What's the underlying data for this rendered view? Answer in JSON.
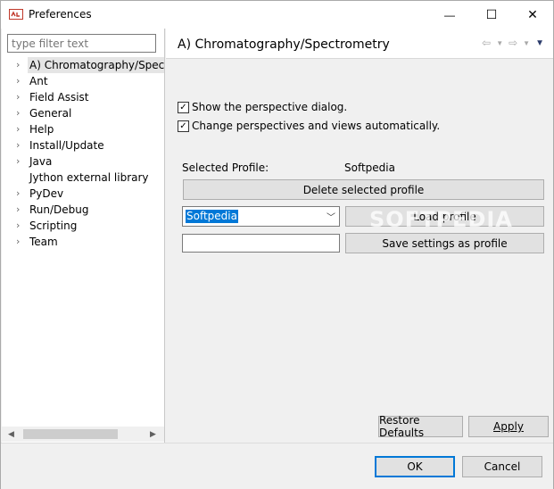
{
  "window": {
    "title": "Preferences",
    "minimize_glyph": "—",
    "maximize_glyph": "☐",
    "close_glyph": "✕"
  },
  "sidebar": {
    "filter_placeholder": "type filter text",
    "items": [
      {
        "label": "A) Chromatography/Spectrometry",
        "expandable": true,
        "selected": true
      },
      {
        "label": "Ant",
        "expandable": true
      },
      {
        "label": "Field Assist",
        "expandable": true
      },
      {
        "label": "General",
        "expandable": true
      },
      {
        "label": "Help",
        "expandable": true
      },
      {
        "label": "Install/Update",
        "expandable": true
      },
      {
        "label": "Java",
        "expandable": true
      },
      {
        "label": "Jython external library",
        "expandable": false
      },
      {
        "label": "PyDev",
        "expandable": true
      },
      {
        "label": "Run/Debug",
        "expandable": true
      },
      {
        "label": "Scripting",
        "expandable": true
      },
      {
        "label": "Team",
        "expandable": true
      }
    ]
  },
  "page": {
    "title": "A) Chromatography/Spectrometry",
    "show_perspective_dialog": {
      "label": "Show the perspective dialog.",
      "checked": true
    },
    "change_perspectives": {
      "label": "Change perspectives and views automatically.",
      "checked": true
    },
    "selected_profile_label": "Selected Profile:",
    "selected_profile_value": "Softpedia",
    "delete_profile_button": "Delete selected profile",
    "profile_combo_value": "Softpedia",
    "load_profile_button": "Load profile",
    "save_settings_button": "Save settings as profile",
    "profile_name_value": "",
    "watermark": "SOFTPEDIA",
    "restore_defaults_button": "Restore Defaults",
    "apply_button": "Apply"
  },
  "footer": {
    "ok_button": "OK",
    "cancel_button": "Cancel"
  },
  "colors": {
    "selection": "#0078d7",
    "button_face": "#e1e1e1",
    "ok_border": "#0078d7"
  }
}
